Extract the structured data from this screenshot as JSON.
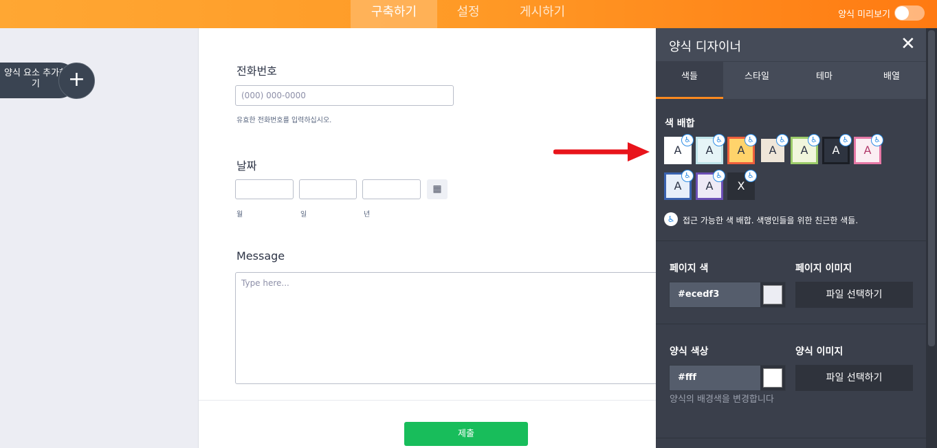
{
  "topbar": {
    "tabs": [
      {
        "label": "구축하기",
        "active": true
      },
      {
        "label": "설정",
        "active": false
      },
      {
        "label": "게시하기",
        "active": false
      }
    ],
    "preview_label": "양식 미리보기",
    "preview_on": false
  },
  "add_element": {
    "label": "양식 요소 추가하기"
  },
  "form": {
    "phone": {
      "label": "전화번호",
      "placeholder": "(000) 000-0000",
      "sublabel": "유효한 전화번호를 입력하십시오."
    },
    "date": {
      "label": "날짜",
      "sublabels": [
        "월",
        "일",
        "년"
      ]
    },
    "message": {
      "label": "Message",
      "placeholder": "Type here..."
    },
    "submit_label": "제출"
  },
  "designer": {
    "title": "양식 디자이너",
    "tabs": [
      {
        "label": "색들",
        "active": true
      },
      {
        "label": "스타일",
        "active": false
      },
      {
        "label": "테마",
        "active": false
      },
      {
        "label": "배열",
        "active": false
      }
    ],
    "scheme_title": "색 배합",
    "schemes": [
      {
        "letter": "A",
        "bg": "#ffffff",
        "border": "#ffffff",
        "fg": "#2c3345",
        "accessible": true
      },
      {
        "letter": "A",
        "bg": "#e6f4f7",
        "border": "#bfe4ea",
        "fg": "#2c3345",
        "accessible": true
      },
      {
        "letter": "A",
        "bg": "#ffd36b",
        "border": "#ef5f3c",
        "fg": "#2c3345",
        "accessible": true
      },
      {
        "letter": "A",
        "bg": "#efe6d9",
        "border": "#3a3f4b",
        "fg": "#2c3345",
        "accessible": true
      },
      {
        "letter": "A",
        "bg": "#f1f6dc",
        "border": "#9ccc6a",
        "fg": "#2c3345",
        "accessible": true
      },
      {
        "letter": "A",
        "bg": "#2e3440",
        "border": "#1b1e25",
        "fg": "#ffffff",
        "accessible": true
      },
      {
        "letter": "A",
        "bg": "#fbeef3",
        "border": "#e678a6",
        "fg": "#b23a6b",
        "accessible": true
      },
      {
        "letter": "A",
        "bg": "#e7effa",
        "border": "#3a62b0",
        "fg": "#2c3345",
        "accessible": true
      },
      {
        "letter": "A",
        "bg": "#eeeaf6",
        "border": "#6b4fb5",
        "fg": "#2c3345",
        "accessible": true
      },
      {
        "letter": "X",
        "bg": "#2b2f37",
        "border": "#2b2f37",
        "fg": "#ffffff",
        "accessible": true
      }
    ],
    "accessible_note": "접근 가능한 색 배합. 색맹인들을 위한 친근한 색들.",
    "page_color": {
      "label": "페이지 색",
      "value": "#ecedf3",
      "swatch": "#ecedf3"
    },
    "page_image": {
      "label": "페이지 이미지",
      "button": "파일 선택하기"
    },
    "form_color": {
      "label": "양식 색상",
      "value": "#fff",
      "swatch": "#ffffff",
      "hint": "양식의 배경색을 변경합니다"
    },
    "form_image": {
      "label": "양식 이미지",
      "button": "파일 선택하기"
    }
  },
  "colors": {
    "accent": "#ff8a1f",
    "submit": "#18bd5b",
    "arrow": "#e8141b"
  }
}
